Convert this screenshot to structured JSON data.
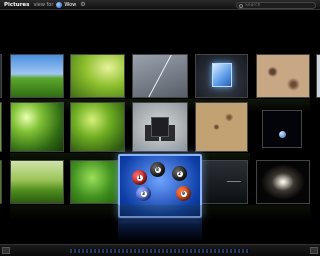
{
  "header": {
    "app_name": "Pictures",
    "view_for_label": "view for",
    "user_name": "Wow",
    "search_placeholder": "Search"
  },
  "icons": {
    "gear": "gear-icon",
    "search": "search-icon",
    "user": "user-icon"
  },
  "gallery": {
    "tiles": [
      {
        "name": "tile-green-field"
      },
      {
        "name": "tile-grass-sunlight"
      },
      {
        "name": "tile-gray-line"
      },
      {
        "name": "tile-blue-cube"
      },
      {
        "name": "tile-sand-texture"
      },
      {
        "name": "tile-leaves-bokeh"
      },
      {
        "name": "tile-leaf-drop"
      },
      {
        "name": "tile-black-boxes"
      },
      {
        "name": "tile-stone-map"
      },
      {
        "name": "tile-earth-space"
      },
      {
        "name": "tile-grass-bottom"
      },
      {
        "name": "tile-green-water"
      },
      {
        "name": "tile-dark-sky"
      },
      {
        "name": "tile-galaxy"
      }
    ],
    "focused": {
      "name": "tile-pool-balls",
      "balls": [
        "8",
        "1",
        "2",
        "3",
        "9"
      ]
    }
  }
}
